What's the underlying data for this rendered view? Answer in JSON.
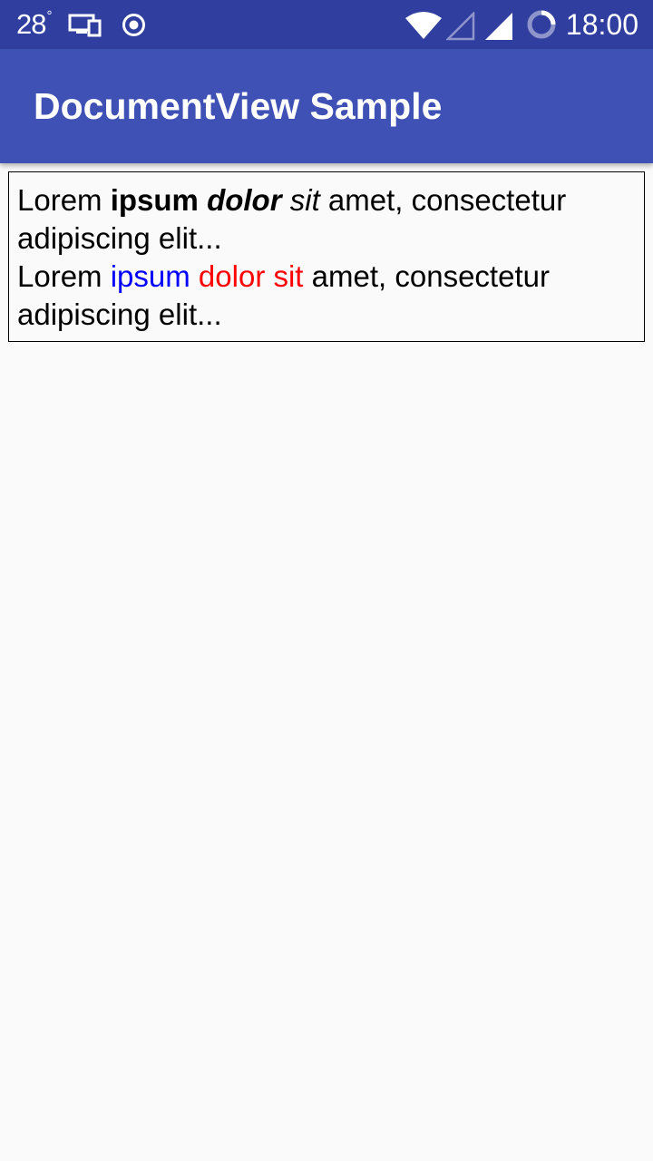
{
  "status_bar": {
    "temperature": "28",
    "degree_symbol": "°",
    "time": "18:00",
    "icons": [
      "devices-icon",
      "record-icon",
      "wifi-icon",
      "signal-empty-icon",
      "signal-full-icon",
      "sync-icon"
    ]
  },
  "app_bar": {
    "title": "DocumentView Sample"
  },
  "document": {
    "paragraph1": {
      "word1": "Lorem",
      "word2_bold": "ipsum",
      "word3_bold_italic": "dolor",
      "word4_italic": "sit",
      "rest": "amet, consectetur adipiscing elit..."
    },
    "paragraph2": {
      "word1": "Lorem",
      "word2_blue": "ipsum",
      "word3_red": "dolor sit",
      "rest": "amet, consectetur adipiscing elit..."
    }
  },
  "colors": {
    "status_bar": "#303f9f",
    "app_bar": "#3f51b5",
    "background": "#fafafa",
    "blue_text": "#0000ff",
    "red_text": "#ff0000"
  }
}
